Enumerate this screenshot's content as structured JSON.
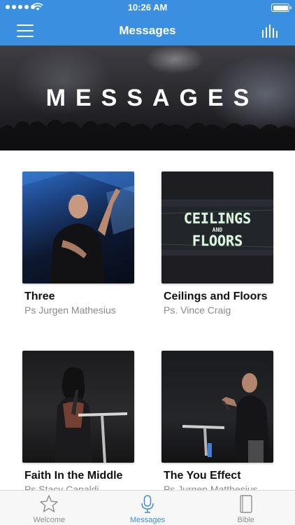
{
  "status_bar": {
    "time": "10:26 AM"
  },
  "nav": {
    "title": "Messages"
  },
  "hero": {
    "title": "MESSAGES"
  },
  "messages": [
    {
      "title": "Three",
      "speaker": "Ps Jurgen Mathesius"
    },
    {
      "title": "Ceilings and Floors",
      "speaker": "Ps. Vince Craig",
      "artwork_text_top": "CEILINGS",
      "artwork_text_mid": "AND",
      "artwork_text_bottom": "FLOORS"
    },
    {
      "title": "Faith In the Middle",
      "speaker": "Ps Stacy Capaldi"
    },
    {
      "title": "The You Effect",
      "speaker": "Ps Jurgen Matthesius"
    }
  ],
  "tabs": [
    {
      "label": "Welcome",
      "icon": "star-icon",
      "active": false
    },
    {
      "label": "Messages",
      "icon": "microphone-icon",
      "active": true
    },
    {
      "label": "Bible",
      "icon": "book-icon",
      "active": false
    }
  ],
  "colors": {
    "accent": "#3b8fe0",
    "tab_inactive": "#8e8e8e"
  }
}
